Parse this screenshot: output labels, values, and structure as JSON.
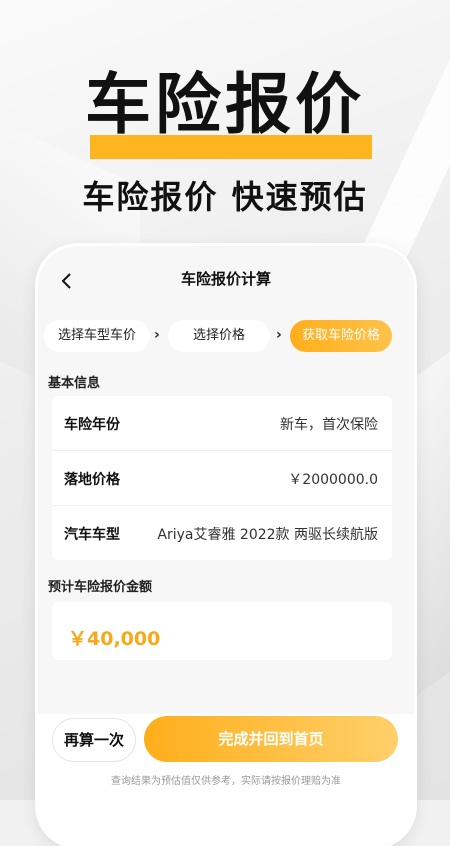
{
  "hero": {
    "title": "车险报价",
    "subtitle": "车险报价 快速预估"
  },
  "nav": {
    "title": "车险报价计算",
    "back_icon": "chevron-left-icon"
  },
  "steps": [
    {
      "label": "选择车型车价",
      "active": false
    },
    {
      "label": "选择价格",
      "active": false
    },
    {
      "label": "获取车险价格",
      "active": true
    }
  ],
  "basic_info": {
    "heading": "基本信息",
    "rows": [
      {
        "key": "车险年份",
        "value": "新车，首次保险"
      },
      {
        "key": "落地价格",
        "value": "￥2000000.0"
      },
      {
        "key": "汽车车型",
        "value": "Ariya艾睿雅 2022款 两驱长续航版"
      }
    ]
  },
  "estimate": {
    "heading": "预计车险报价金额",
    "amount": "￥40,000"
  },
  "footer": {
    "again_label": "再算一次",
    "done_label": "完成并回到首页",
    "disclaimer": "查询结果为预估值仅供参考，实际请按报价理赔为准"
  },
  "colors": {
    "accent": "#ffae1a",
    "amount": "#f7a91a"
  }
}
